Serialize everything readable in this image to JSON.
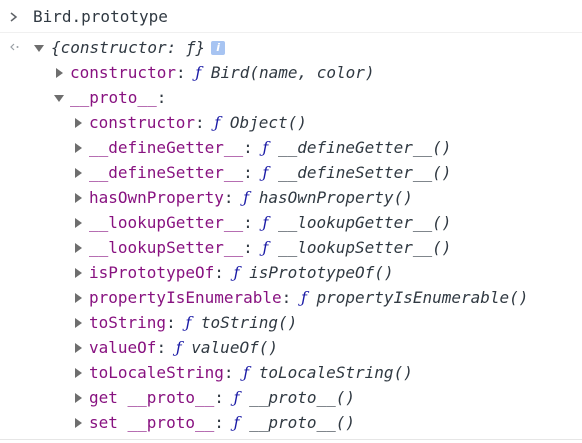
{
  "console": {
    "input": "Bird.prototype",
    "result": {
      "summary": "{constructor: ƒ}",
      "info_badge": "i",
      "constructor_key": "constructor",
      "constructor_value": "Bird(name, color)",
      "proto_key": "__proto__",
      "proto_entries": [
        {
          "key": "constructor",
          "value": "Object()"
        },
        {
          "key": "__defineGetter__",
          "value": "__defineGetter__()"
        },
        {
          "key": "__defineSetter__",
          "value": "__defineSetter__()"
        },
        {
          "key": "hasOwnProperty",
          "value": "hasOwnProperty()"
        },
        {
          "key": "__lookupGetter__",
          "value": "__lookupGetter__()"
        },
        {
          "key": "__lookupSetter__",
          "value": "__lookupSetter__()"
        },
        {
          "key": "isPrototypeOf",
          "value": "isPrototypeOf()"
        },
        {
          "key": "propertyIsEnumerable",
          "value": "propertyIsEnumerable()"
        },
        {
          "key": "toString",
          "value": "toString()"
        },
        {
          "key": "valueOf",
          "value": "valueOf()"
        },
        {
          "key": "toLocaleString",
          "value": "toLocaleString()"
        },
        {
          "key": "get __proto__",
          "value": "__proto__()"
        },
        {
          "key": "set __proto__",
          "value": "__proto__()"
        }
      ]
    },
    "function_glyph": "ƒ",
    "colon": ":"
  },
  "colors": {
    "key": "#881280",
    "function_glyph": "#1a1aa6",
    "text": "#303942",
    "info_badge": "#a7c4f2"
  },
  "icons": {
    "prompt": "chevron-right-icon",
    "result": "result-return-icon",
    "expand_collapsed": "triangle-right-icon",
    "expand_open": "triangle-down-icon",
    "info": "info-icon"
  }
}
